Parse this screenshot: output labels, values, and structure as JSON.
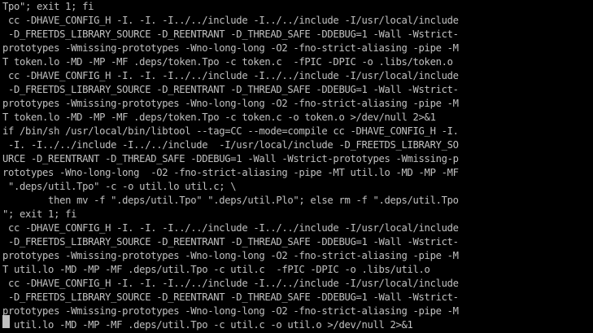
{
  "terminal": {
    "colors": {
      "background": "#000000",
      "foreground": "#c0c0c0",
      "cursor": "#c0c0c0"
    },
    "lines": [
      "Tpo\"; exit 1; fi",
      " cc -DHAVE_CONFIG_H -I. -I. -I../../include -I../../include -I/usr/local/include",
      " -D_FREETDS_LIBRARY_SOURCE -D_REENTRANT -D_THREAD_SAFE -DDEBUG=1 -Wall -Wstrict-",
      "prototypes -Wmissing-prototypes -Wno-long-long -O2 -fno-strict-aliasing -pipe -M",
      "T token.lo -MD -MP -MF .deps/token.Tpo -c token.c  -fPIC -DPIC -o .libs/token.o",
      " cc -DHAVE_CONFIG_H -I. -I. -I../../include -I../../include -I/usr/local/include",
      " -D_FREETDS_LIBRARY_SOURCE -D_REENTRANT -D_THREAD_SAFE -DDEBUG=1 -Wall -Wstrict-",
      "prototypes -Wmissing-prototypes -Wno-long-long -O2 -fno-strict-aliasing -pipe -M",
      "T token.lo -MD -MP -MF .deps/token.Tpo -c token.c -o token.o >/dev/null 2>&1",
      "if /bin/sh /usr/local/bin/libtool --tag=CC --mode=compile cc -DHAVE_CONFIG_H -I.",
      " -I. -I../../include -I../../include  -I/usr/local/include -D_FREETDS_LIBRARY_SO",
      "URCE -D_REENTRANT -D_THREAD_SAFE -DDEBUG=1 -Wall -Wstrict-prototypes -Wmissing-p",
      "rototypes -Wno-long-long  -O2 -fno-strict-aliasing -pipe -MT util.lo -MD -MP -MF",
      " \".deps/util.Tpo\" -c -o util.lo util.c; \\",
      "        then mv -f \".deps/util.Tpo\" \".deps/util.Plo\"; else rm -f \".deps/util.Tpo",
      "\"; exit 1; fi",
      " cc -DHAVE_CONFIG_H -I. -I. -I../../include -I../../include -I/usr/local/include",
      " -D_FREETDS_LIBRARY_SOURCE -D_REENTRANT -D_THREAD_SAFE -DDEBUG=1 -Wall -Wstrict-",
      "prototypes -Wmissing-prototypes -Wno-long-long -O2 -fno-strict-aliasing -pipe -M",
      "T util.lo -MD -MP -MF .deps/util.Tpo -c util.c  -fPIC -DPIC -o .libs/util.o",
      " cc -DHAVE_CONFIG_H -I. -I. -I../../include -I../../include -I/usr/local/include",
      " -D_FREETDS_LIBRARY_SOURCE -D_REENTRANT -D_THREAD_SAFE -DDEBUG=1 -Wall -Wstrict-",
      "prototypes -Wmissing-prototypes -Wno-long-long -O2 -fno-strict-aliasing -pipe -M",
      "T util.lo -MD -MP -MF .deps/util.Tpo -c util.c -o util.o >/dev/null 2>&1"
    ]
  }
}
